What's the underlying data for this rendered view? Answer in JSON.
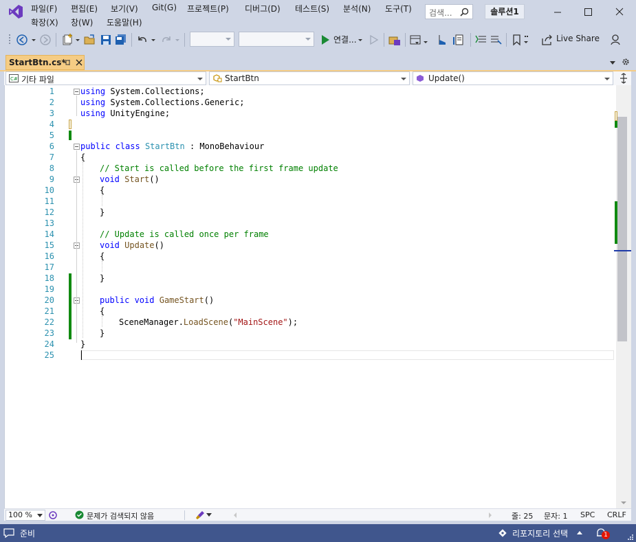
{
  "menu": {
    "file": "파일(F)",
    "edit": "편집(E)",
    "view": "보기(V)",
    "git": "Git(G)",
    "project": "프로젝트(P)",
    "debug": "디버그(D)",
    "test": "테스트(S)",
    "analyze": "분석(N)",
    "tools": "도구(T)",
    "extensions": "확장(X)",
    "window": "창(W)",
    "help": "도움말(H)"
  },
  "search": {
    "placeholder": "검색..."
  },
  "solution_name": "솔루션1",
  "toolbar": {
    "run_label": "연결...",
    "live_share": "Live Share"
  },
  "tab": {
    "title": "StartBtn.cs*"
  },
  "navbar": {
    "project": "기타 파일",
    "class": "StartBtn",
    "member": "Update()"
  },
  "editor": {
    "line_numbers": [
      "1",
      "2",
      "3",
      "4",
      "5",
      "6",
      "7",
      "8",
      "9",
      "10",
      "11",
      "12",
      "13",
      "14",
      "15",
      "16",
      "17",
      "18",
      "19",
      "20",
      "21",
      "22",
      "23",
      "24",
      "25"
    ],
    "lines": {
      "l1_kw": "using",
      "l1_rest": " System.Collections;",
      "l2_kw": "using",
      "l2_rest": " System.Collections.Generic;",
      "l3_kw": "using",
      "l3_rest": " UnityEngine;",
      "l6_kw": "public class",
      "l6_type": "StartBtn",
      "l6_rest": " : MonoBehaviour",
      "l7": "{",
      "l8": "// Start is called before the first frame update",
      "l9_kw": "void",
      "l9_fn": "Start",
      "l9_rest": "()",
      "l10": "{",
      "l12": "}",
      "l14": "// Update is called once per frame",
      "l15_kw": "void",
      "l15_fn": "Update",
      "l15_rest": "()",
      "l16": "{",
      "l18": "}",
      "l20_kw": "public void",
      "l20_fn": "GameStart",
      "l20_rest": "()",
      "l21": "{",
      "l22_a": "SceneManager.",
      "l22_fn": "LoadScene",
      "l22_b": "(",
      "l22_str": "\"MainScene\"",
      "l22_c": ");",
      "l23": "}",
      "l24": "}"
    }
  },
  "editor_status": {
    "zoom": "100 %",
    "issues": "문제가 검색되지 않음",
    "line": "줄: 25",
    "col": "문자: 1",
    "spc": "SPC",
    "eol": "CRLF"
  },
  "statusbar": {
    "ready": "준비",
    "repo": "리포지토리 선택",
    "notifications": "1"
  },
  "colors": {
    "accent_tab": "#f5cc84",
    "statusbar": "#40568d",
    "change_bar": "#108a10"
  }
}
